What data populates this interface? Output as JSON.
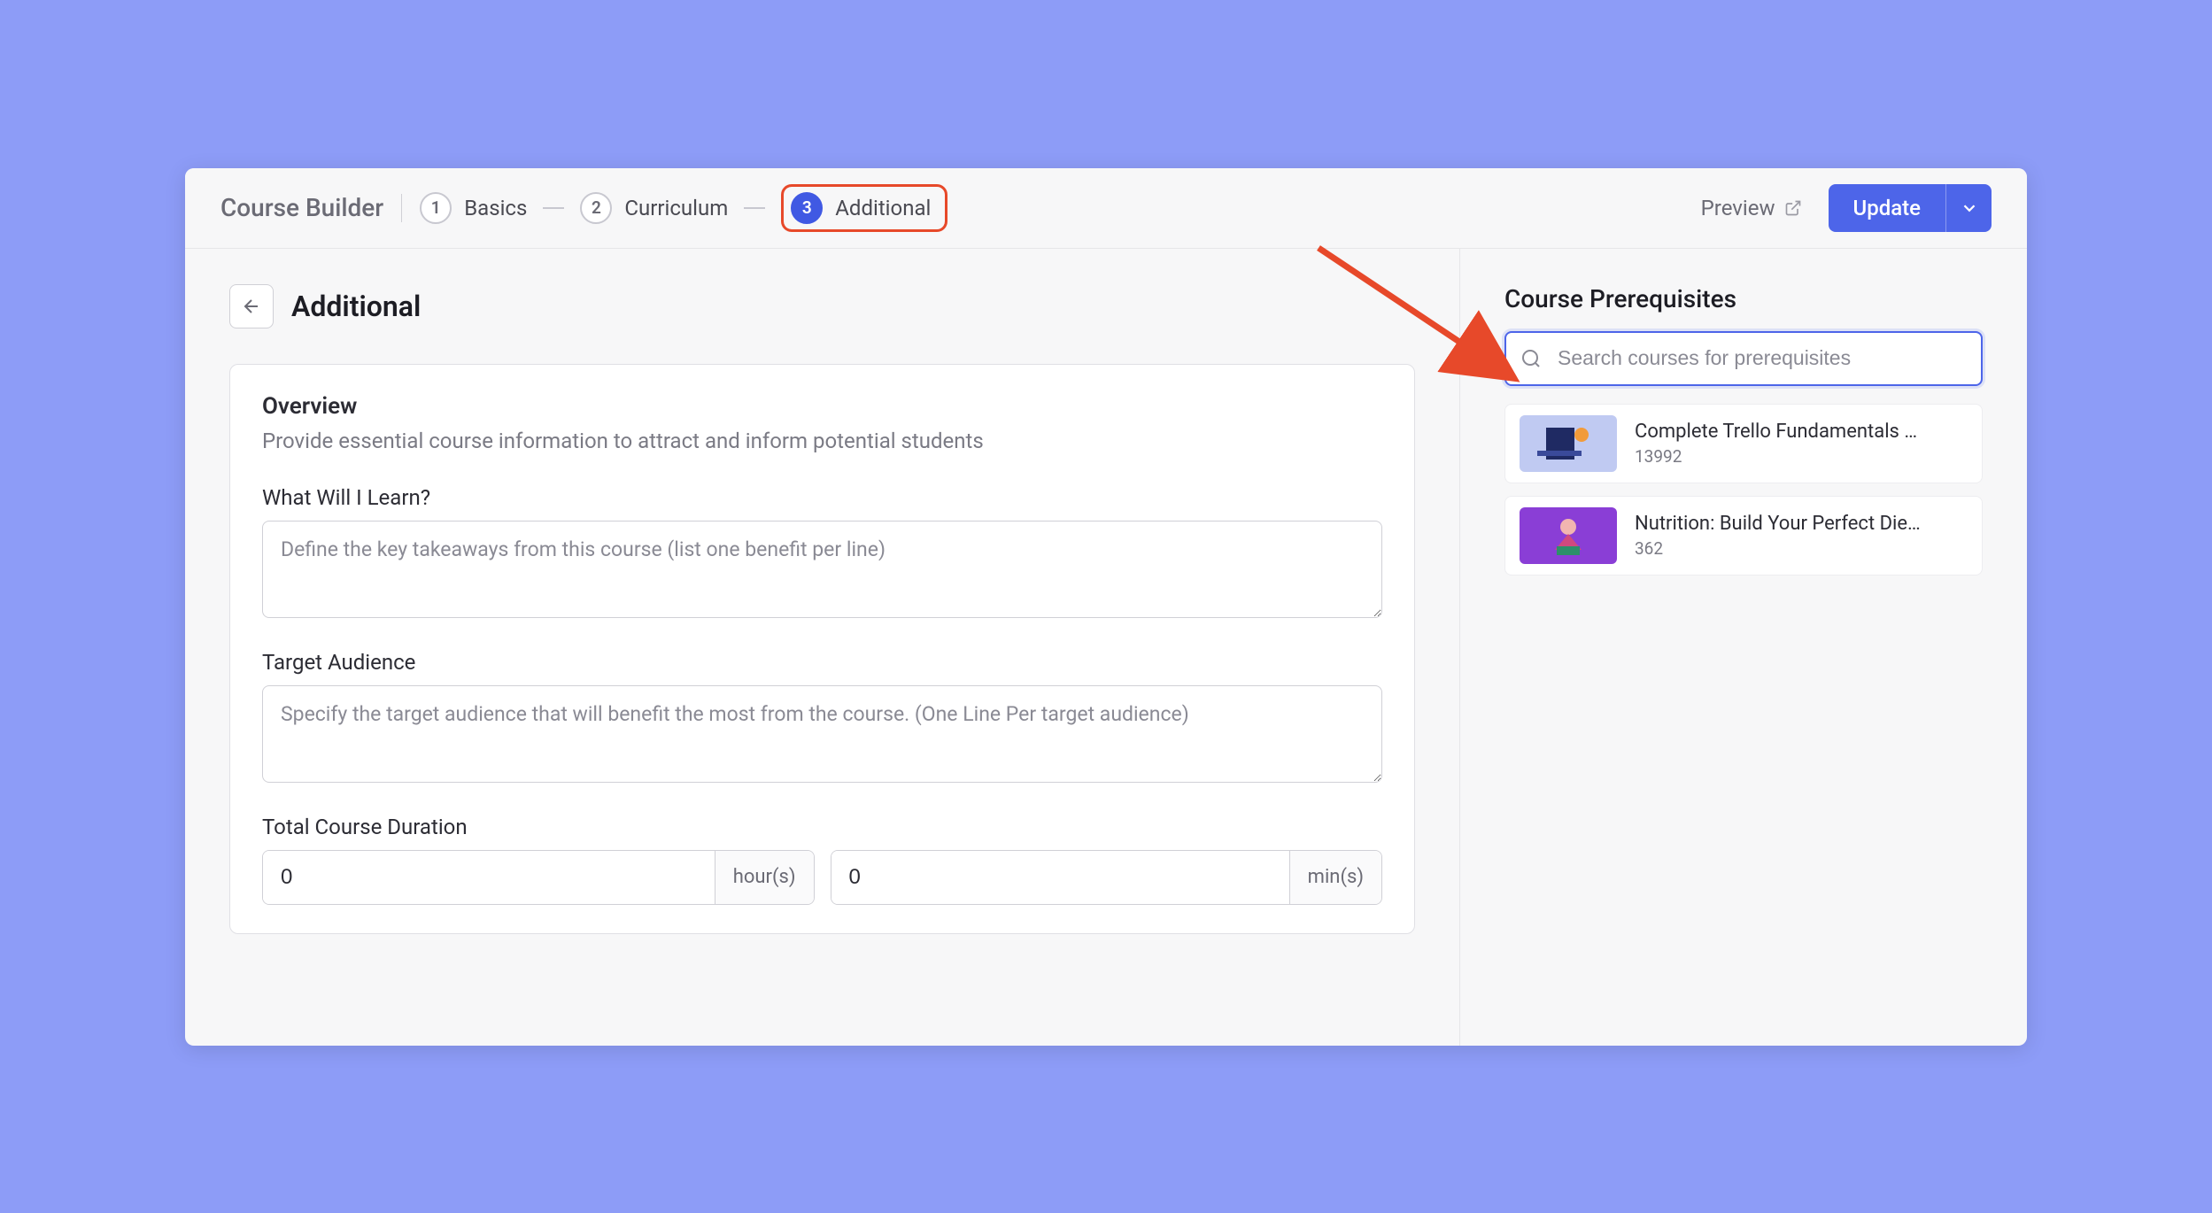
{
  "app": {
    "title": "Course Builder"
  },
  "steps": [
    {
      "num": "1",
      "label": "Basics"
    },
    {
      "num": "2",
      "label": "Curriculum"
    },
    {
      "num": "3",
      "label": "Additional"
    }
  ],
  "topbar": {
    "preview": "Preview",
    "update": "Update"
  },
  "page": {
    "title": "Additional"
  },
  "overview": {
    "heading": "Overview",
    "subtitle": "Provide essential course information to attract and inform potential students",
    "what_learn_label": "What Will I Learn?",
    "what_learn_placeholder": "Define the key takeaways from this course (list one benefit per line)",
    "target_label": "Target Audience",
    "target_placeholder": "Specify the target audience that will benefit the most from the course. (One Line Per target audience)",
    "duration_label": "Total Course Duration",
    "hours_value": "0",
    "hours_suffix": "hour(s)",
    "mins_value": "0",
    "mins_suffix": "min(s)"
  },
  "prereq": {
    "heading": "Course Prerequisites",
    "search_placeholder": "Search courses for prerequisites",
    "items": [
      {
        "title": "Complete Trello Fundamentals …",
        "count": "13992",
        "thumb_bg": "#c0caf2"
      },
      {
        "title": "Nutrition: Build Your Perfect Die…",
        "count": "362",
        "thumb_bg": "#8a3ed6"
      }
    ]
  }
}
